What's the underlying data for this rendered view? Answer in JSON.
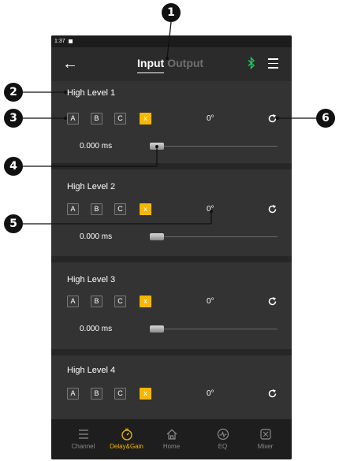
{
  "status": {
    "time": "1:37"
  },
  "header": {
    "back_icon": "arrow-left-icon",
    "tabs": [
      {
        "label": "Input",
        "active": true
      },
      {
        "label": "Output",
        "active": false
      }
    ],
    "bluetooth_icon": "bluetooth-icon",
    "menu_icon": "hamburger-menu-icon",
    "bluetooth_color": "#22c55e"
  },
  "channels": [
    {
      "name": "High Level 1",
      "phase_buttons": [
        "A",
        "B",
        "C",
        "x"
      ],
      "phase": "0°",
      "delay": "0.000 ms",
      "delay_level": 0
    },
    {
      "name": "High Level 2",
      "phase_buttons": [
        "A",
        "B",
        "C",
        "x"
      ],
      "phase": "0°",
      "delay": "0.000 ms",
      "delay_level": 0
    },
    {
      "name": "High Level 3",
      "phase_buttons": [
        "A",
        "B",
        "C",
        "x"
      ],
      "phase": "0°",
      "delay": "0.000 ms",
      "delay_level": 0
    },
    {
      "name": "High Level 4",
      "phase_buttons": [
        "A",
        "B",
        "C",
        "x"
      ],
      "phase": "0°"
    }
  ],
  "bottom_nav": [
    {
      "label": "Channel",
      "icon": "list-icon",
      "active": false
    },
    {
      "label": "Delay&Gain",
      "icon": "timer-icon",
      "active": true
    },
    {
      "label": "Home",
      "icon": "home-icon",
      "active": false
    },
    {
      "label": "EQ",
      "icon": "eq-icon",
      "active": false
    },
    {
      "label": "Mixer",
      "icon": "mixer-icon",
      "active": false
    }
  ],
  "callouts": [
    "1",
    "2",
    "3",
    "4",
    "5",
    "6"
  ],
  "colors": {
    "accent": "#f5b800",
    "background": "#333333",
    "nav_background": "#1e1e1e"
  }
}
